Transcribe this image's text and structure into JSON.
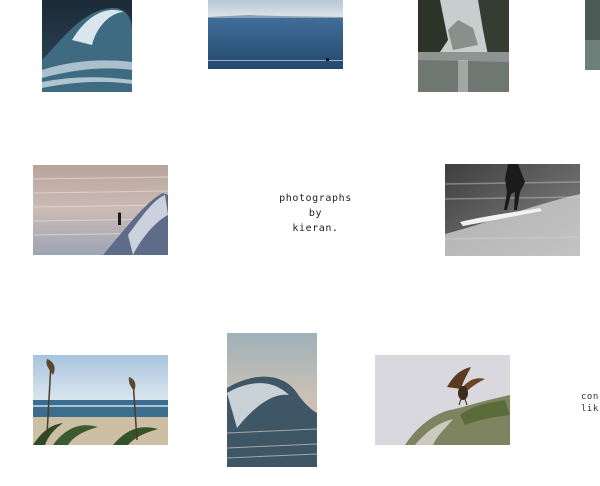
{
  "title": {
    "line1": "photographs",
    "line2": "by",
    "line3": "kieran."
  },
  "side_text": {
    "line1": "con",
    "line2": "lik"
  }
}
